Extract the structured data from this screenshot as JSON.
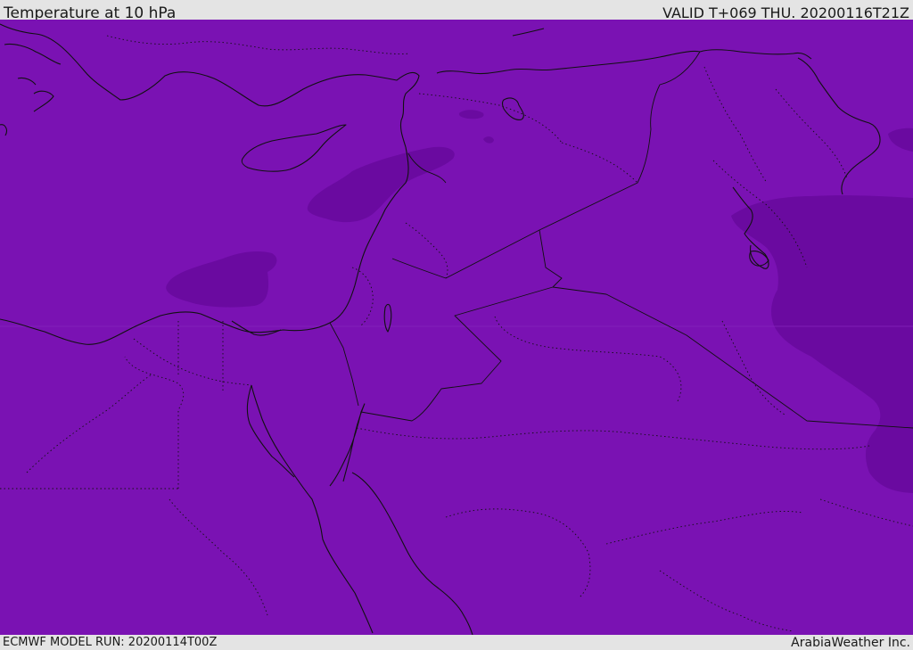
{
  "header": {
    "title": "Temperature at 10 hPa",
    "valid_time": "VALID T+069 THU. 20200116T21Z"
  },
  "footer": {
    "model_run": "ECMWF MODEL RUN: 20200114T00Z",
    "credit": "ArabiaWeather Inc."
  },
  "map": {
    "background_color": "#7a12b3",
    "cold_shade_color": "#6a0aa0",
    "coastline_color": "#111111",
    "region": "Eastern Mediterranean and Middle East"
  }
}
